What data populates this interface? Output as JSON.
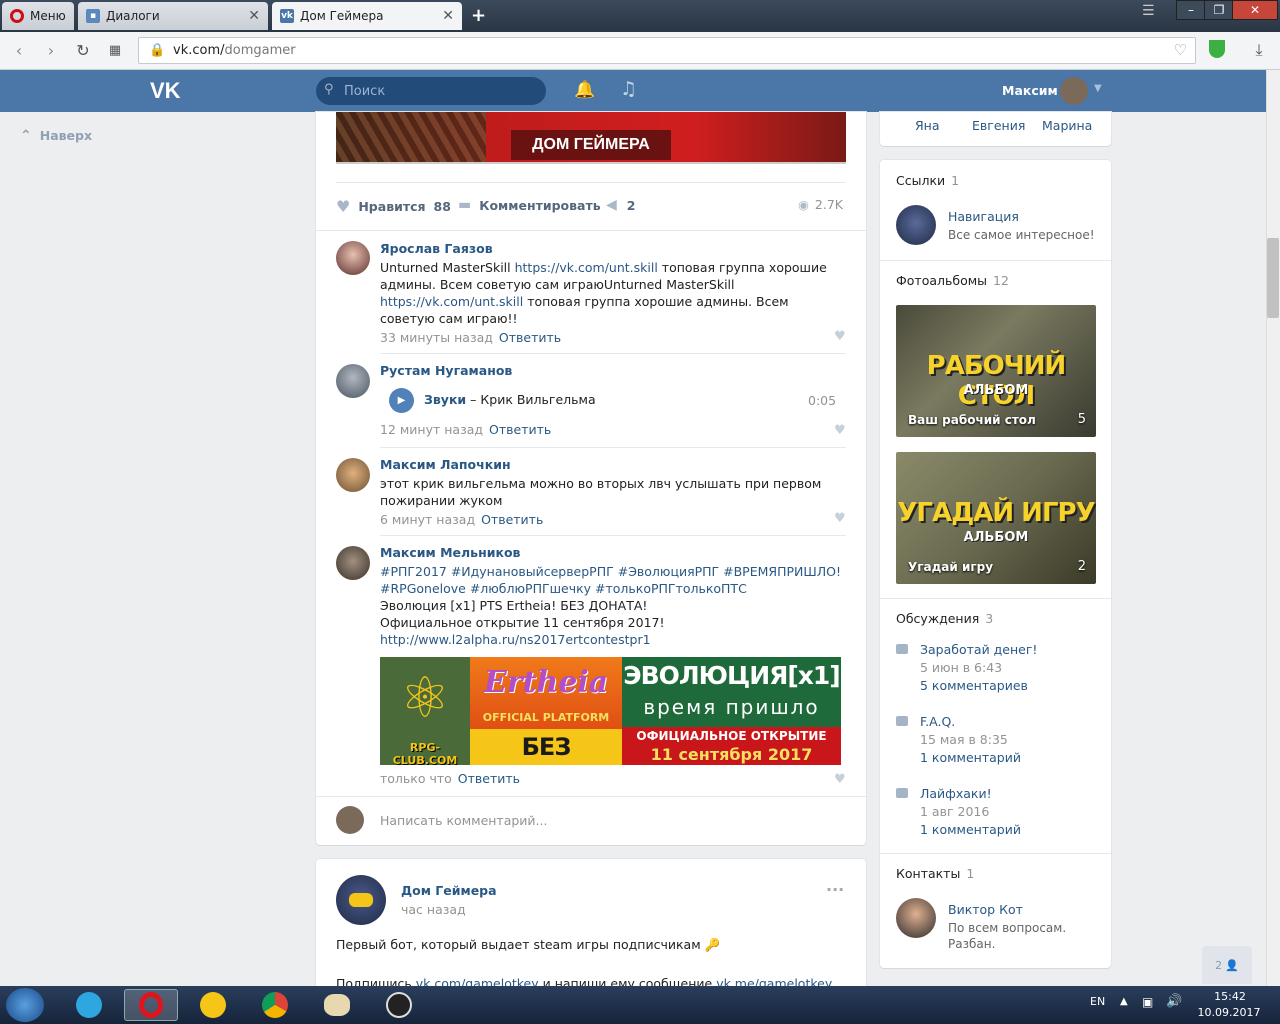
{
  "browser": {
    "menu_label": "Меню",
    "tabs": [
      {
        "label": "Диалоги",
        "active": false
      },
      {
        "label": "Дом Геймера",
        "active": true
      }
    ],
    "new_tab": "+",
    "url_host": "vk.com/",
    "url_path": "domgamer"
  },
  "header": {
    "logo": "VK",
    "search_placeholder": "Поиск",
    "user_name": "Максим"
  },
  "left_nav": {
    "up_label": "Наверх"
  },
  "post_top": {
    "banner_text": "ДОМ ГЕЙМЕРА",
    "like_label": "Нравится",
    "like_count": "88",
    "comment_label": "Комментировать",
    "share_count": "2",
    "views": "2.7K"
  },
  "comments": [
    {
      "author": "Ярослав Гаязов",
      "text_before": "Unturned MasterSkill ",
      "link1": "https://vk.com/unt.skill",
      "text_mid": " топовая группа хорошие админы. Всем советую сам играюUnturned MasterSkill ",
      "link2": "https://vk.com/unt.skill",
      "text_after": " топовая группа хорошие админы. Всем советую сам играю!!",
      "time": "33 минуты назад",
      "reply": "Ответить"
    },
    {
      "author": "Рустам Нугаманов",
      "audio_artist": "Звуки",
      "audio_title": "– Крик Вильгельма",
      "audio_duration": "0:05",
      "time": "12 минут назад",
      "reply": "Ответить"
    },
    {
      "author": "Максим Лапочкин",
      "text": "этот крик вильгельма можно во вторых лвч услышать при первом пожирании жуком",
      "time": "6 минут назад",
      "reply": "Ответить"
    },
    {
      "author": "Максим Мельников",
      "hashtags": "#РПГ2017 #ИдунановыйсерверРПГ #ЭволюцияРПГ #ВРЕМЯПРИШЛО! #RPGonelove #люблюРПГшечку #толькоРПГтолькоПТС",
      "line1": "Эволюция [x1] PTS Ertheia! БЕЗ ДОНАТА!",
      "line2": "Официальное открытие 11 сентября 2017!",
      "link": "http://www.l2alpha.ru/ns2017ertcontestpr1",
      "banner": {
        "site": "RPG-CLUB.COM",
        "game": "Ertheia",
        "platform": "OFFICIAL PLATFORM",
        "nodonate": "БЕЗ ДОНАТА",
        "evo": "ЭВОЛЮЦИЯ[x1]",
        "time": "время пришло",
        "open1": "ОФИЦИАЛЬНОЕ ОТКРЫТИЕ",
        "open2": "11 сентября 2017"
      },
      "time": "только что",
      "reply": "Ответить"
    }
  ],
  "write_comment_placeholder": "Написать комментарий...",
  "post2": {
    "author": "Дом Геймера",
    "time": "час назад",
    "text": "Первый бот, который выдает steam игры подписчикам",
    "line2_prefix": "Подпишись ",
    "line2_link1": "vk.com/gamelotkey",
    "line2_mid": " и напиши ему сообщение ",
    "line2_link2": "vk.me/gamelotkey",
    "more": "···"
  },
  "right": {
    "friends": [
      "Яна",
      "Евгения",
      "Марина"
    ],
    "links_title": "Ссылки",
    "links_count": "1",
    "link_name": "Навигация",
    "link_desc": "Все самое интересное!",
    "albums_title": "Фотоальбомы",
    "albums_count": "12",
    "albums": [
      {
        "big": "РАБОЧИЙ СТОЛ",
        "sub": "АЛЬБОМ",
        "label": "Ваш рабочий стол",
        "count": "5"
      },
      {
        "big": "УГАДАЙ ИГРУ",
        "sub": "АЛЬБОМ",
        "label": "Угадай игру",
        "count": "2"
      }
    ],
    "discussions_title": "Обсуждения",
    "discussions_count": "3",
    "discussions": [
      {
        "title": "Заработай денег!",
        "date": "5 июн в 6:43",
        "comments": "5 комментариев"
      },
      {
        "title": "F.A.Q.",
        "date": "15 мая в 8:35",
        "comments": "1 комментарий"
      },
      {
        "title": "Лайфхаки!",
        "date": "1 авг 2016",
        "comments": "1 комментарий"
      }
    ],
    "contacts_title": "Контакты",
    "contacts_count": "1",
    "contact_name": "Виктор Кот",
    "contact_desc": "По всем вопросам. Разбан.",
    "online_count": "2"
  },
  "taskbar": {
    "lang": "EN",
    "time": "15:42",
    "date": "10.09.2017"
  },
  "colors": {
    "vk_blue": "#4a76a8",
    "link": "#2a5885",
    "muted": "#939393"
  }
}
